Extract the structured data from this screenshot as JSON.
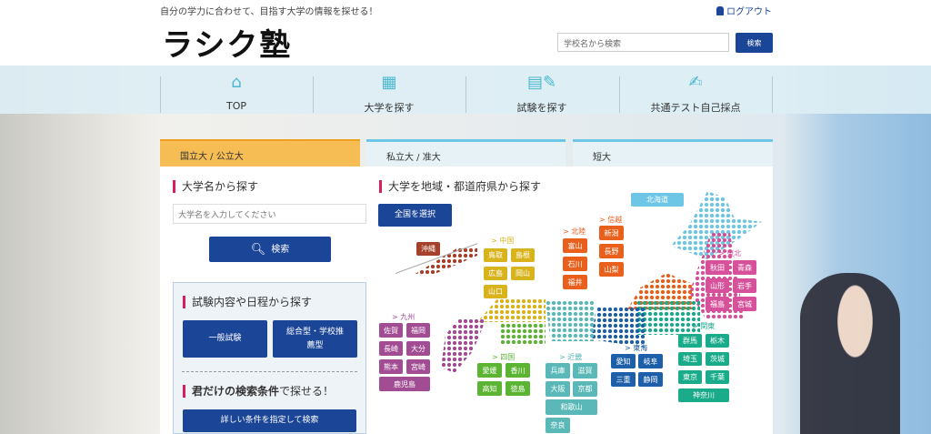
{
  "header": {
    "tagline": "自分の学力に合わせて、目指す大学の情報を探せる！",
    "logout": "ログアウト",
    "logo": "ラシク塾",
    "search_placeholder": "学校名から検索",
    "search_button": "検索"
  },
  "nav": [
    {
      "label": "TOP",
      "icon": "home-icon"
    },
    {
      "label": "大学を探す",
      "icon": "building-icon"
    },
    {
      "label": "試験を探す",
      "icon": "document-pen-icon"
    },
    {
      "label": "共通テスト自己採点",
      "icon": "test-check-icon"
    }
  ],
  "tabs": [
    {
      "label": "国立大 / 公立大",
      "active": true
    },
    {
      "label": "私立大 / 准大",
      "active": false
    },
    {
      "label": "短大",
      "active": false
    }
  ],
  "name_search": {
    "heading": "大学名から探す",
    "placeholder": "大学名を入力してください",
    "button": "検索"
  },
  "exam_search": {
    "heading": "試験内容や日程から探す",
    "general": "一般試験",
    "comprehensive": "総合型・学校推薦型",
    "condition_heading_bold": "君だけの検索条件",
    "condition_heading_rest": "で探せる！",
    "condition_button": "詳しい条件を指定して検索"
  },
  "region_search": {
    "heading": "大学を地域・都道府県から探す",
    "all_button": "全国を選択"
  },
  "regions": {
    "hokkaido": {
      "color": "#6ec6e6",
      "prefs": [
        "北海道"
      ]
    },
    "okinawa": {
      "color": "#a5402a",
      "prefs": [
        "沖縄"
      ]
    },
    "chugoku": {
      "label": "> 中国",
      "color": "#d9b31c",
      "prefs": [
        "鳥取",
        "島根",
        "広島",
        "岡山",
        "山口"
      ]
    },
    "hokuriku": {
      "label": "> 北陸",
      "color": "#e8601c",
      "prefs": [
        "富山",
        "石川",
        "福井"
      ]
    },
    "shinetsu": {
      "label": "> 信越",
      "color": "#e8601c",
      "prefs": [
        "新潟",
        "長野",
        "山梨"
      ]
    },
    "tohoku": {
      "label": "> 東北",
      "color": "#d6509a",
      "prefs": [
        "秋田",
        "青森",
        "山形",
        "岩手",
        "福島",
        "宮城"
      ]
    },
    "kyushu": {
      "label": "> 九州",
      "color": "#a24c93",
      "prefs": [
        "佐賀",
        "福岡",
        "長崎",
        "大分",
        "熊本",
        "宮崎",
        "鹿児島"
      ]
    },
    "shikoku": {
      "label": "> 四国",
      "color": "#5bb432",
      "prefs": [
        "愛媛",
        "香川",
        "高知",
        "徳島"
      ]
    },
    "kinki": {
      "label": "> 近畿",
      "color": "#5bb8b8",
      "prefs": [
        "兵庫",
        "滋賀",
        "大阪",
        "京都",
        "和歌山",
        "奈良"
      ]
    },
    "tokai": {
      "label": "> 東海",
      "color": "#1d5fa8",
      "prefs": [
        "愛知",
        "岐阜",
        "三重",
        "静岡"
      ]
    },
    "kanto": {
      "label": "> 関東",
      "color": "#1aab8a",
      "prefs": [
        "群馬",
        "栃木",
        "埼玉",
        "茨城",
        "東京",
        "千葉",
        "神奈川"
      ]
    }
  }
}
